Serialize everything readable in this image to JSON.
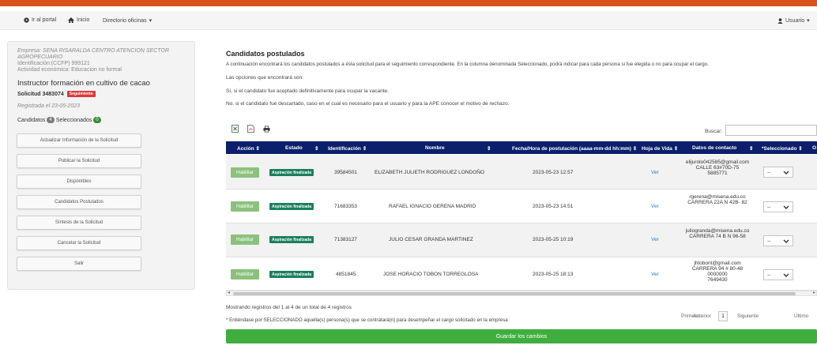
{
  "nav": {
    "portal": "Ir al portal",
    "home": "Inicio",
    "offices": "Directorio oficinas",
    "user": "Usuario"
  },
  "sidebar": {
    "company": "Empresa: SENA RISARALDA CENTRO ATENCION SECTOR AGROPECUARIO",
    "ident": "Identificación:(CCFP) 999121",
    "activity": "Actividad económica: Educacion no formal",
    "job_title": "Instructor formación en cultivo de cacao",
    "request": "Solicitud 3483074",
    "request_badge": "Seguimiento",
    "registered": "Registrada el 23-05-2023",
    "candidates_label": "Candidatos",
    "candidates_count": "4",
    "selected_label": "Seleccionados",
    "selected_count": "0",
    "buttons": [
      "Actualizar Información de la Solicitud",
      "Publicar la Solicitud",
      "Disponibles",
      "Candidatos Postulados",
      "Síntesis de la Solicitud",
      "Cancelar la Solicitud",
      "Salir"
    ]
  },
  "main": {
    "title": "Candidatos postulados",
    "intro": "A continuación encontrará los candidatos postulados a ésta solicitud para el seguimiento correspondiente. En la columna denominada Seleccionado, podrá indicar para cada persona si fue elegida o no para ocupar el cargo.",
    "options_label": "Las opciones que encontrará son:",
    "opt_yes": "Sí, si el candidato fue aceptado definitivamente para ocupar la vacante.",
    "opt_no": "No, si el candidato fue descartado, caso en el cual es necesario para el usuario y para la APE conocer el motivo de rechazo.",
    "search_label": "Buscar:",
    "search_value": ""
  },
  "table": {
    "headers": {
      "action": "Acción",
      "state": "Estado",
      "id": "Identificación",
      "name": "Nombre",
      "date": "Fecha/Hora de postulación (aaaa-mm-dd hh:mm)",
      "cv": "Hoja de Vida",
      "contact": "Datos de contacto",
      "selected": "*Seleccionado",
      "extra": "O"
    },
    "rows": [
      {
        "action": "Habilitar",
        "state": "Aspiración finalizada",
        "id": "39584501",
        "name": "ELIZABETH JULIETH RODRIGUEZ LONDOÑO",
        "date": "2023-05-23 12:57",
        "cv": "Ver",
        "contact": [
          "elijurolo042585@gmail.com",
          "CALLE 63#70D-75",
          "5885771"
        ],
        "selected": "--"
      },
      {
        "action": "Habilitar",
        "state": "Aspiración finalizada",
        "id": "71683353",
        "name": "RAFAEL IGNACIO GERENA MADRID",
        "date": "2023-05-23 14:51",
        "cv": "Ver",
        "contact": [
          "rgerena@misena.edu.co",
          "CARRERA 22A N 42B- 82"
        ],
        "selected": "--"
      },
      {
        "action": "Habilitar",
        "state": "Aspiración finalizada",
        "id": "71383127",
        "name": "JULIO CESAR GRANDA MARTINEZ",
        "date": "2023-05-25 10:19",
        "cv": "Ver",
        "contact": [
          "juliogranda@misena.edu.co",
          "CARRERA 74 B N 96-58"
        ],
        "selected": "--"
      },
      {
        "action": "Habilitar",
        "state": "Aspiración finalizada",
        "id": "4851845",
        "name": "JOSE HORACIO TOBON TORREGLOSA",
        "date": "2023-05-25 18:13",
        "cv": "Ver",
        "contact": [
          "jhtobont@gmail.com",
          "CARRERA 94 # 80-48",
          "0000000",
          "7649430"
        ],
        "selected": "--"
      }
    ]
  },
  "footer": {
    "info": "Mostrando registros del 1 al 4 de un total de 4 registros",
    "note": "* Entiéndase por SELECCIONADO aquella(s) persona(s) que se contratará(n) para desempeñar el cargo solicitado en la empresa",
    "first": "Primero",
    "prev": "Anterior",
    "page": "1",
    "next": "Siguiente",
    "last": "Último",
    "save": "Guardar los cambios"
  },
  "colors": {
    "accent_bar": "#d9531e",
    "table_header": "#0b1f6b",
    "save_button": "#3fae3f",
    "state_tag": "#1b7f5e",
    "enable_button": "#8bc17d"
  }
}
